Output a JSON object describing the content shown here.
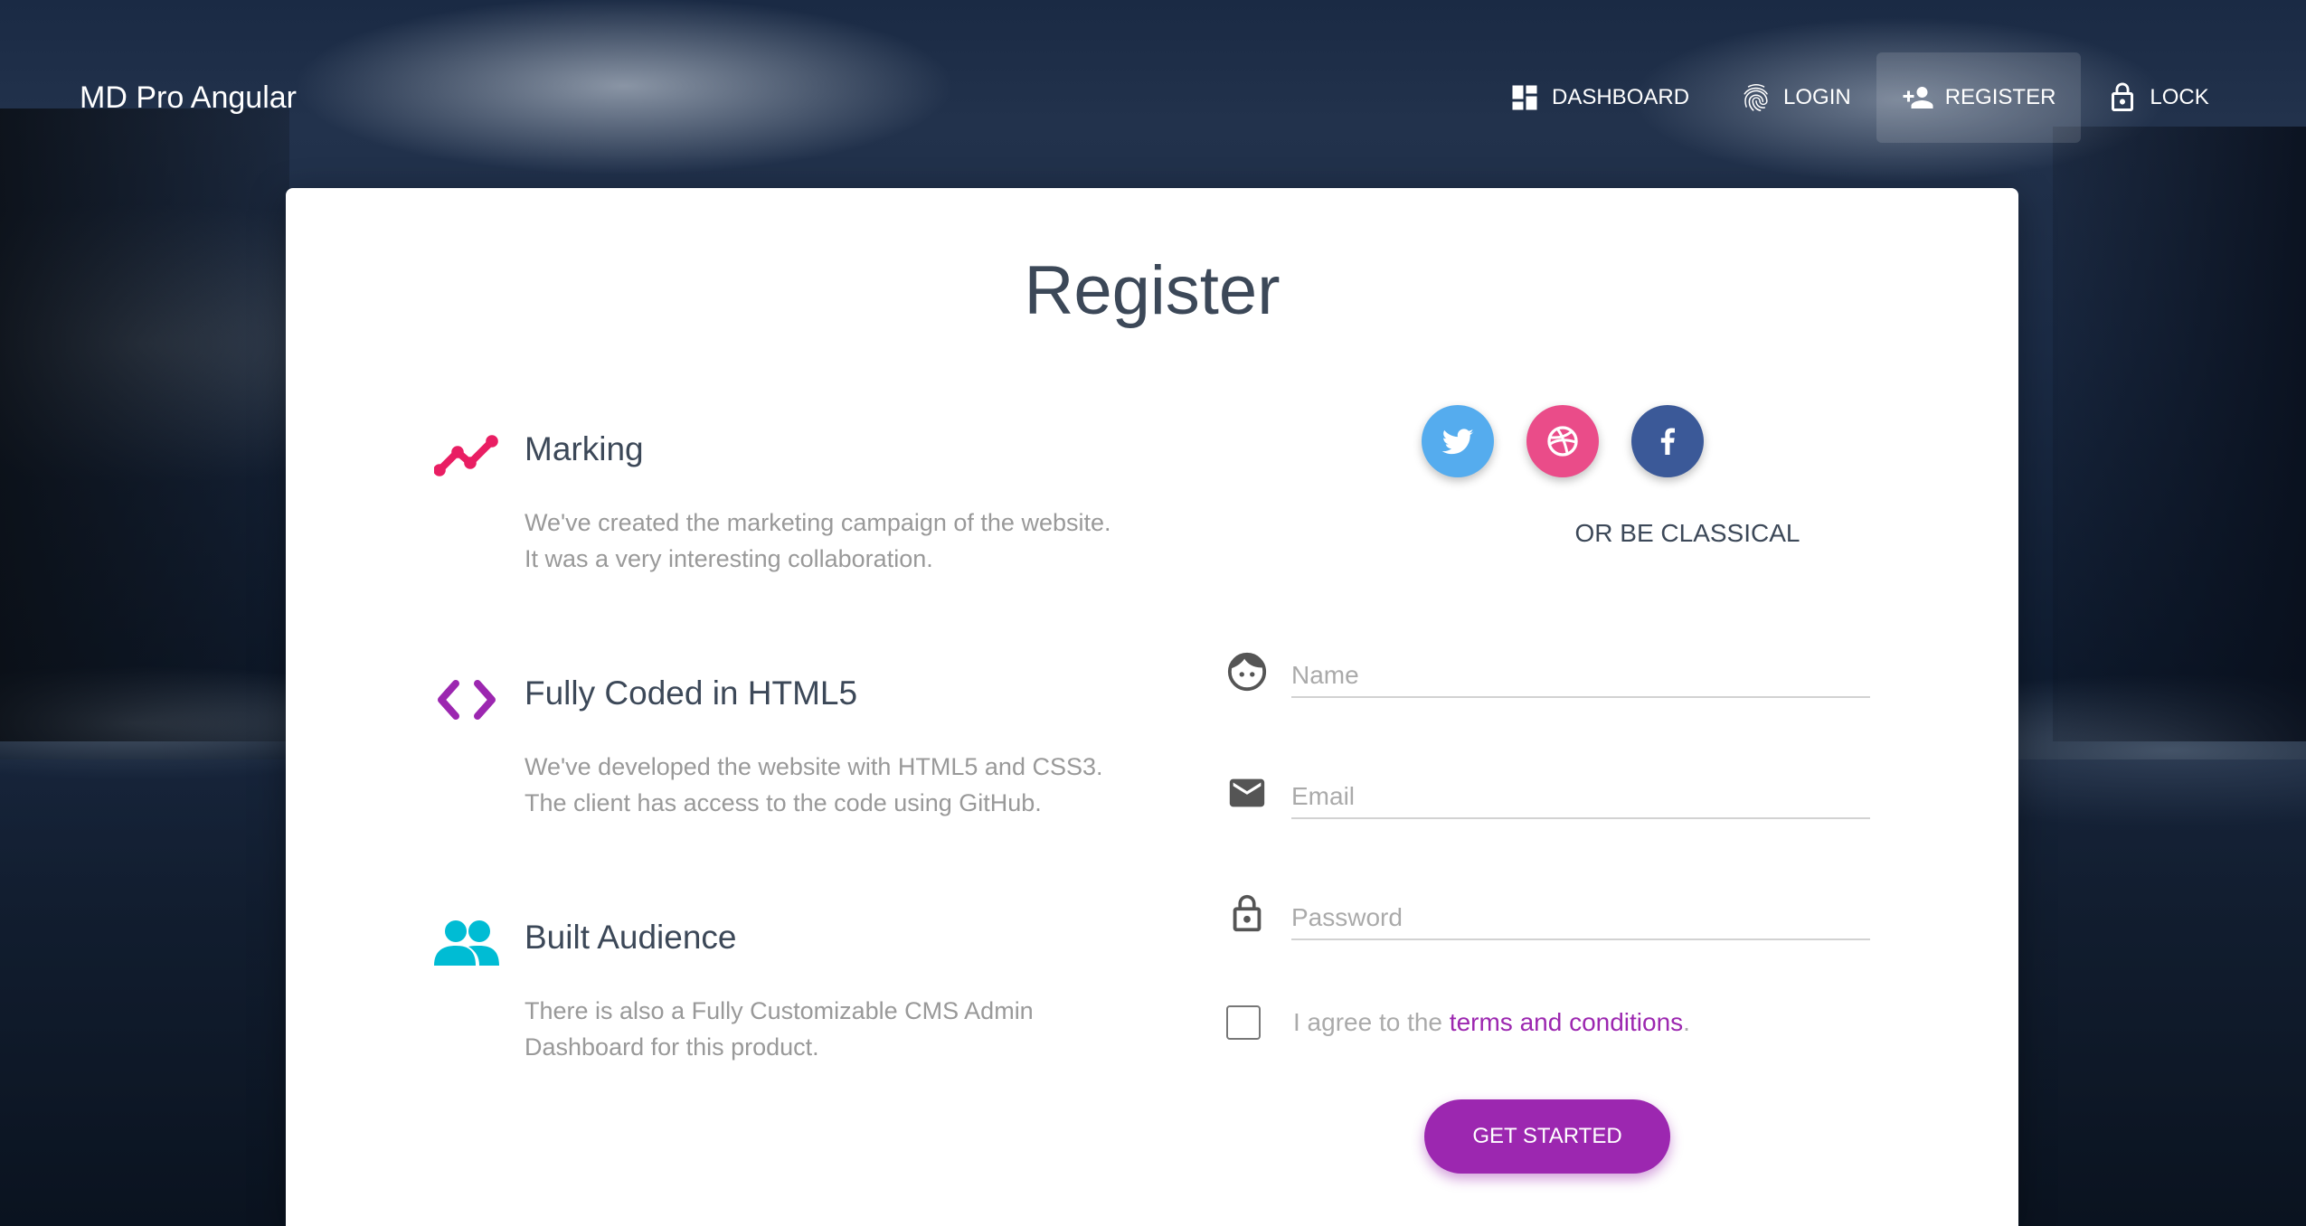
{
  "brand": "MD Pro Angular",
  "nav": {
    "dashboard": "DASHBOARD",
    "login": "LOGIN",
    "register": "REGISTER",
    "lock": "LOCK"
  },
  "card": {
    "title": "Register",
    "features": [
      {
        "title": "Marking",
        "desc_line1": "We've created the marketing campaign of the website.",
        "desc_line2": "It was a very interesting collaboration.",
        "icon": "timeline-icon",
        "color": "#e91e63"
      },
      {
        "title": "Fully Coded in HTML5",
        "desc_line1": "We've developed the website with HTML5 and CSS3.",
        "desc_line2": "The client has access to the code using GitHub.",
        "icon": "code-icon",
        "color": "#9c27b0"
      },
      {
        "title": "Built Audience",
        "desc_line1": "There is also a Fully Customizable CMS Admin",
        "desc_line2": "Dashboard for this product.",
        "icon": "group-icon",
        "color": "#00bcd4"
      }
    ],
    "socials": [
      {
        "name": "twitter",
        "color": "#55acee"
      },
      {
        "name": "dribbble",
        "color": "#ea4c89"
      },
      {
        "name": "facebook",
        "color": "#3b5998"
      }
    ],
    "or_text": "OR BE CLASSICAL",
    "form": {
      "name_placeholder": "Name",
      "email_placeholder": "Email",
      "password_placeholder": "Password",
      "agree_prefix": "I agree to the ",
      "agree_link": "terms and conditions",
      "agree_suffix": ".",
      "submit": "GET STARTED"
    }
  },
  "colors": {
    "accent": "#9c27b0",
    "title": "#3c4858"
  }
}
